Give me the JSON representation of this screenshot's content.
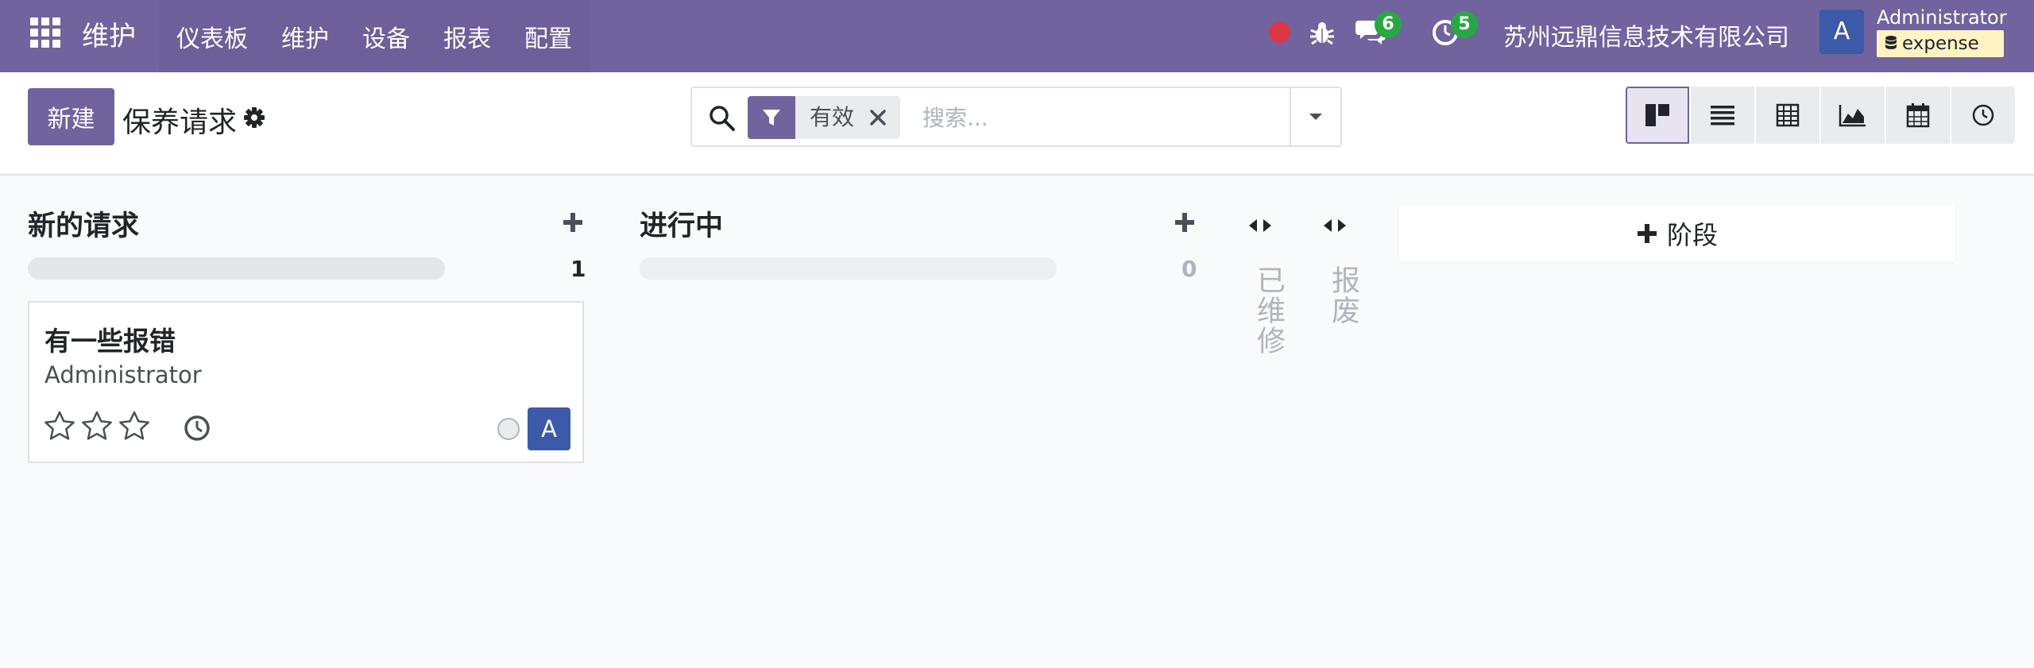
{
  "navbar": {
    "brand": "维护",
    "menu": [
      "仪表板",
      "维护",
      "设备",
      "报表",
      "配置"
    ],
    "messages_count": "6",
    "activities_count": "5",
    "company": "苏州远鼎信息技术有限公司",
    "user_initial": "A",
    "user_name": "Administrator",
    "database": "expense"
  },
  "control": {
    "new_label": "新建",
    "title": "保养请求",
    "facet_label": "有效",
    "search_placeholder": "搜索..."
  },
  "views": [
    "kanban",
    "list",
    "pivot",
    "graph",
    "calendar",
    "activity"
  ],
  "kanban": {
    "columns": [
      {
        "title": "新的请求",
        "count": "1"
      },
      {
        "title": "进行中",
        "count": "0"
      }
    ],
    "folded": [
      "已维修",
      "报废"
    ],
    "add_stage_label": "阶段",
    "card": {
      "title": "有一些报错",
      "user": "Administrator",
      "avatar_initial": "A",
      "stars": 0
    }
  },
  "colors": {
    "brand": "#71639e",
    "badge": "#28a745",
    "avatar": "#3d5aa8"
  }
}
